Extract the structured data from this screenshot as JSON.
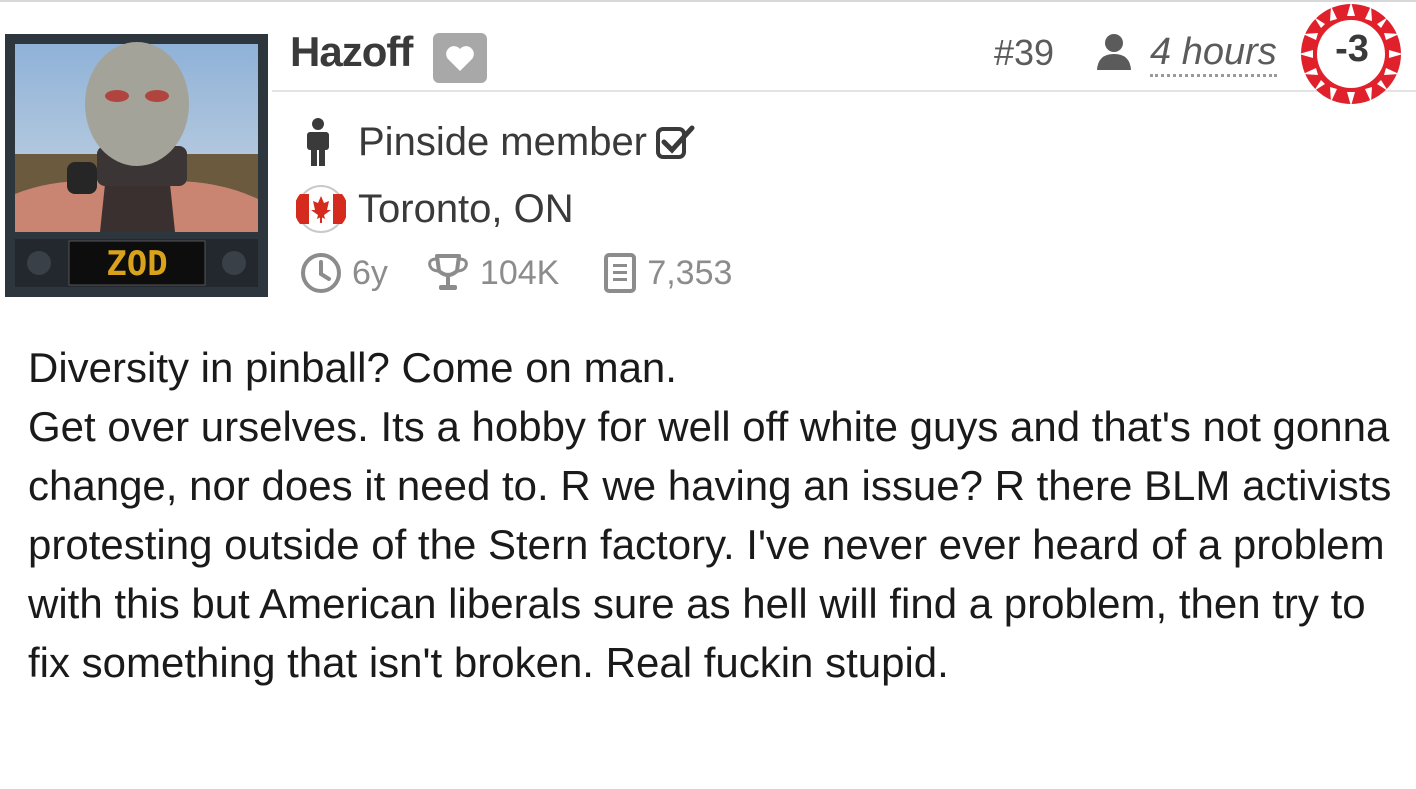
{
  "post": {
    "username": "Hazoff",
    "number": "#39",
    "time": "4 hours",
    "score": "-3",
    "avatar_text": "ZOD",
    "member": {
      "title": "Pinside member",
      "location": "Toronto, ON",
      "account_age": "6y",
      "karma": "104K",
      "posts": "7,353"
    },
    "body_lines": [
      "Diversity in pinball? Come on man.",
      "Get over urselves. Its a hobby for well off white guys and that's not gonna change, nor does it need to. R we having an issue? R there BLM activists protesting outside of the Stern factory. I've never ever heard of a problem with this but American liberals sure as hell will find a problem, then try to fix something that isn't broken. Real fuckin stupid."
    ]
  },
  "colors": {
    "score_red": "#e0202a",
    "muted": "#8c8c8c",
    "badge_gray": "#a8a8a8"
  },
  "icons": [
    "heart-icon",
    "user-icon",
    "person-icon",
    "checkbox-check-icon",
    "canada-flag-icon",
    "clock-icon",
    "trophy-icon",
    "document-icon"
  ]
}
